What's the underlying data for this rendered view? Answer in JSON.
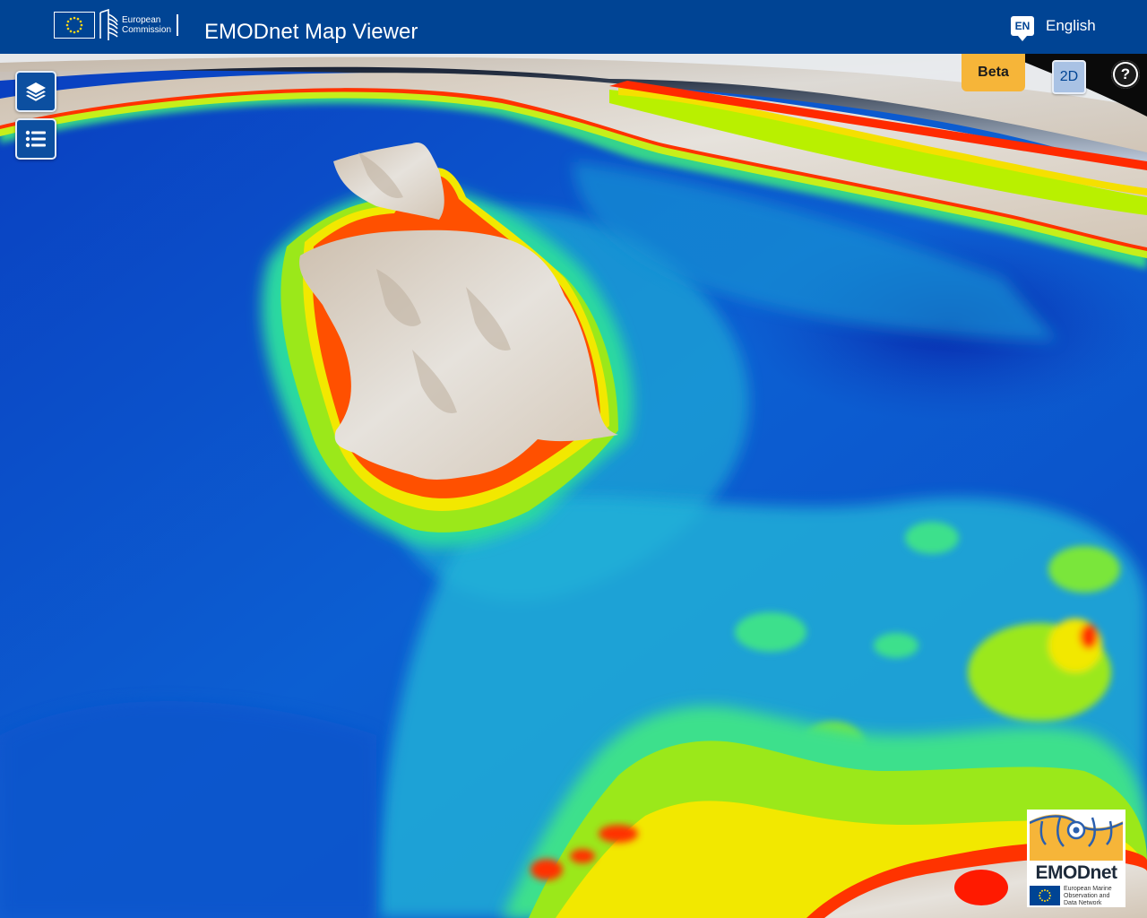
{
  "header": {
    "ec_logo_line1": "European",
    "ec_logo_line2": "Commission",
    "title": "EMODnet Map Viewer",
    "language_code": "EN",
    "language_label": "English"
  },
  "toolbar": {
    "layers_button": "layers-icon",
    "legend_button": "list-icon"
  },
  "controls": {
    "beta_label": "Beta",
    "view_mode_label": "2D",
    "help_label": "?"
  },
  "footer_logo": {
    "name": "EMODnet",
    "line1": "European Marine",
    "line2": "Observation and",
    "line3": "Data Network"
  },
  "map": {
    "depth_palette": [
      "#0a2fb5",
      "#0d64d6",
      "#1fb6d8",
      "#3ee08c",
      "#b8f000",
      "#f7e600",
      "#ff5a00",
      "#e00000"
    ],
    "land_color": "#d9d3cb"
  }
}
